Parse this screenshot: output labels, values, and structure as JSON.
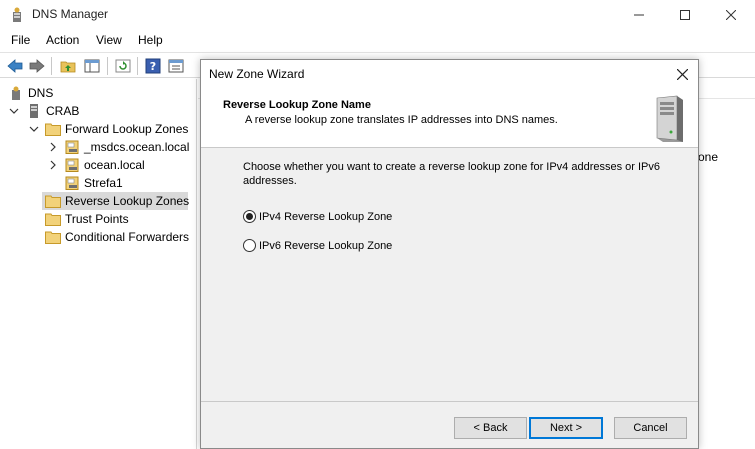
{
  "window": {
    "title": "DNS Manager",
    "icon": "dns-manager-icon"
  },
  "menu": {
    "items": [
      "File",
      "Action",
      "View",
      "Help"
    ]
  },
  "toolbar": {
    "buttons": [
      "back-icon",
      "forward-icon",
      "up-folder-icon",
      "show-hide-tree-icon",
      "refresh-icon",
      "help-icon",
      "properties-icon"
    ]
  },
  "tree": {
    "root": "DNS",
    "server": "CRAB",
    "forward_zones": "Forward Lookup Zones",
    "zones": [
      "_msdcs.ocean.local",
      "ocean.local",
      "Strefa1"
    ],
    "reverse_zones": "Reverse Lookup Zones",
    "trust_points": "Trust Points",
    "conditional_forwarders": "Conditional Forwarders"
  },
  "background": {
    "peek_text": "one"
  },
  "dialog": {
    "title": "New Zone Wizard",
    "heading": "Reverse Lookup Zone Name",
    "subheading": "A reverse lookup zone translates IP addresses into DNS names.",
    "description": "Choose whether you want to create a reverse lookup zone for IPv4 addresses or IPv6 addresses.",
    "options": [
      {
        "label": "IPv4 Reverse Lookup Zone",
        "selected": true
      },
      {
        "label": "IPv6 Reverse Lookup Zone",
        "selected": false
      }
    ],
    "back_label": "< Back",
    "next_label": "Next >",
    "cancel_label": "Cancel"
  },
  "colors": {
    "accent": "#0078d7",
    "folder": "#e8c25a",
    "selection": "#d9d9d9"
  }
}
